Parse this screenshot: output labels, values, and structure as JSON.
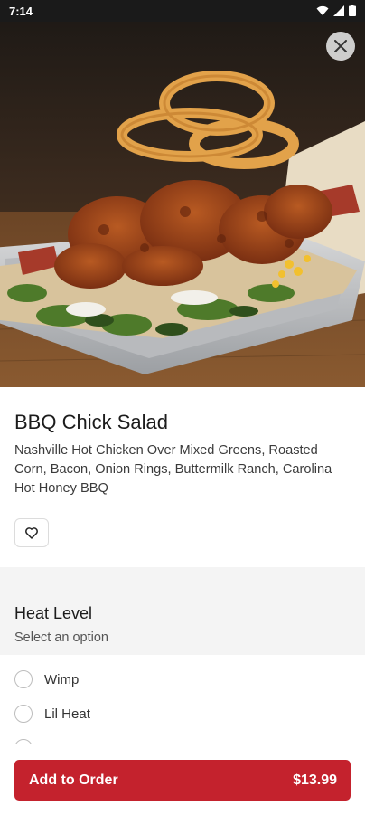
{
  "status_bar": {
    "time": "7:14",
    "icons": [
      "wifi-icon",
      "signal-icon",
      "battery-icon"
    ]
  },
  "item": {
    "name": "BBQ Chick Salad",
    "description": "Nashville Hot Chicken Over Mixed Greens, Roasted Corn, Bacon, Onion Rings, Buttermilk Ranch, Carolina Hot Honey BBQ",
    "favorite_icon": "heart-icon",
    "close_icon": "close-icon"
  },
  "heat_level": {
    "title": "Heat Level",
    "subtitle": "Select an option",
    "options": [
      {
        "label": "Wimp",
        "selected": false
      },
      {
        "label": "Lil Heat",
        "selected": false
      }
    ]
  },
  "order": {
    "button_label": "Add to Order",
    "price": "$13.99"
  },
  "colors": {
    "accent": "#c4222d",
    "status_bar": "#1a1a1a"
  }
}
